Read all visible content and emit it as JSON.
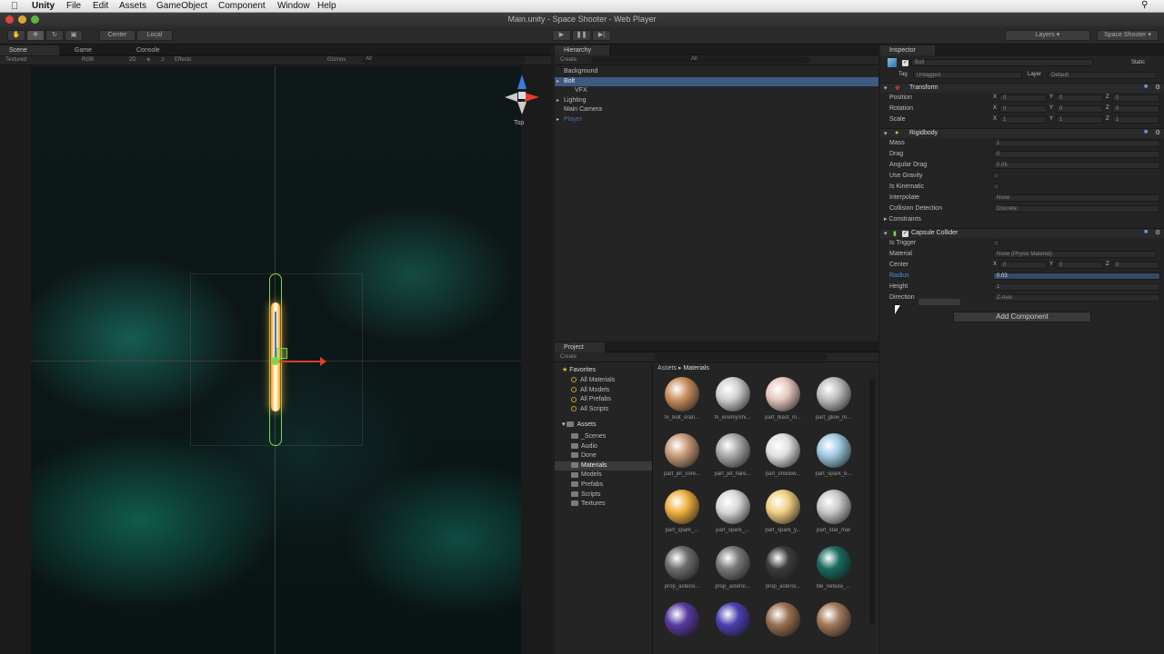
{
  "menubar": {
    "apple": "",
    "app": "Unity",
    "items": [
      "File",
      "Edit",
      "Assets",
      "GameObject",
      "Component",
      "Window",
      "Help"
    ]
  },
  "window": {
    "title": "Main.unity - Space Shooter - Web Player"
  },
  "toolbar": {
    "pivot": "Center",
    "space": "Local",
    "layers": "Layers",
    "layout": "Space Shooter"
  },
  "scene": {
    "tabs": [
      "Scene",
      "Game",
      "Console"
    ],
    "bar": {
      "shading": "Textured",
      "rgb": "RGB",
      "mode2d": "2D",
      "effects": "Effects",
      "gizmos": "Gizmos",
      "search": "All"
    },
    "gizmo_label": "Top"
  },
  "hierarchy": {
    "title": "Hierarchy",
    "create": "Create",
    "search": "All",
    "items": [
      {
        "label": "Background",
        "indent": 0,
        "selected": false,
        "dim": false,
        "arrow": false
      },
      {
        "label": "Bolt",
        "indent": 0,
        "selected": true,
        "dim": false,
        "arrow": true
      },
      {
        "label": "VFX",
        "indent": 1,
        "selected": false,
        "dim": false,
        "arrow": false
      },
      {
        "label": "Lighting",
        "indent": 0,
        "selected": false,
        "dim": false,
        "arrow": true
      },
      {
        "label": "Main Camera",
        "indent": 0,
        "selected": false,
        "dim": false,
        "arrow": false
      },
      {
        "label": "Player",
        "indent": 0,
        "selected": false,
        "dim": true,
        "arrow": true
      }
    ]
  },
  "project": {
    "title": "Project",
    "create": "Create",
    "favorites_label": "Favorites",
    "favorites": [
      "All Materials",
      "All Models",
      "All Prefabs",
      "All Scripts"
    ],
    "assets_label": "Assets",
    "folders": [
      "_Scenes",
      "Audio",
      "Done",
      "Materials",
      "Models",
      "Prefabs",
      "Scripts",
      "Textures"
    ],
    "selected_folder": "Materials",
    "breadcrumb": [
      "Assets",
      "Materials"
    ],
    "thumbs": [
      {
        "label": "fx_bolt_oran...",
        "color": "#c89060"
      },
      {
        "label": "fx_enemyShi...",
        "color": "#d0d0d0"
      },
      {
        "label": "part_blast_m...",
        "color": "#e6c8c0"
      },
      {
        "label": "part_glow_m...",
        "color": "#bdbdbd"
      },
      {
        "label": "part_jet_core...",
        "color": "#c89a78"
      },
      {
        "label": "part_jet_flare...",
        "color": "#a8a8a8"
      },
      {
        "label": "part_shockw...",
        "color": "#e0e0e0"
      },
      {
        "label": "part_spark_b...",
        "color": "#9ec8e0"
      },
      {
        "label": "part_spark_...",
        "color": "#f0b040"
      },
      {
        "label": "part_spark_...",
        "color": "#d8d8d8"
      },
      {
        "label": "part_spark_y...",
        "color": "#f0d080"
      },
      {
        "label": "part_star_mat",
        "color": "#c8c8c8"
      },
      {
        "label": "prop_asteroi...",
        "color": "#6e6e6e"
      },
      {
        "label": "prop_asteroi...",
        "color": "#7a7a7a"
      },
      {
        "label": "prop_asteroi...",
        "color": "#3c3c3c"
      },
      {
        "label": "tile_nebula_...",
        "color": "#1a6a60"
      },
      {
        "label": "",
        "color": "#5a3aa0"
      },
      {
        "label": "",
        "color": "#4a40b0"
      },
      {
        "label": "",
        "color": "#9a7050"
      },
      {
        "label": "",
        "color": "#a07858"
      }
    ]
  },
  "inspector": {
    "title": "Inspector",
    "object_name": "Bolt",
    "static_label": "Static",
    "tag_label": "Tag",
    "tag_value": "Untagged",
    "layer_label": "Layer",
    "layer_value": "Default",
    "transform": {
      "title": "Transform",
      "rows": [
        {
          "label": "Position",
          "x": "0",
          "y": "0",
          "z": "0"
        },
        {
          "label": "Rotation",
          "x": "0",
          "y": "0",
          "z": "0"
        },
        {
          "label": "Scale",
          "x": "1",
          "y": "1",
          "z": "1"
        }
      ]
    },
    "rigidbody": {
      "title": "Rigidbody",
      "rows": [
        {
          "label": "Mass",
          "value": "1"
        },
        {
          "label": "Drag",
          "value": "0"
        },
        {
          "label": "Angular Drag",
          "value": "0.05"
        },
        {
          "label": "Use Gravity",
          "value": ""
        },
        {
          "label": "Is Kinematic",
          "value": ""
        },
        {
          "label": "Interpolate",
          "value": "None"
        },
        {
          "label": "Collision Detection",
          "value": "Discrete"
        }
      ],
      "constraints": "Constraints"
    },
    "collider": {
      "title": "Capsule Collider",
      "is_trigger": "Is Trigger",
      "material_label": "Material",
      "material_value": "None (Physic Material)",
      "center_label": "Center",
      "center": {
        "x": "0",
        "y": "0",
        "z": "0"
      },
      "radius_label": "Radius",
      "radius_value": "0.03",
      "height_label": "Height",
      "height_value": "1",
      "direction_label": "Direction",
      "direction_value": "Z-Axis"
    },
    "add_component": "Add Component"
  },
  "colors": {
    "accent_blue": "#3a72b0",
    "selection": "#3d5a80",
    "bolt_core": "#fff3c0",
    "collider_green": "#7cd84a",
    "axis_red": "#e03c2a"
  }
}
